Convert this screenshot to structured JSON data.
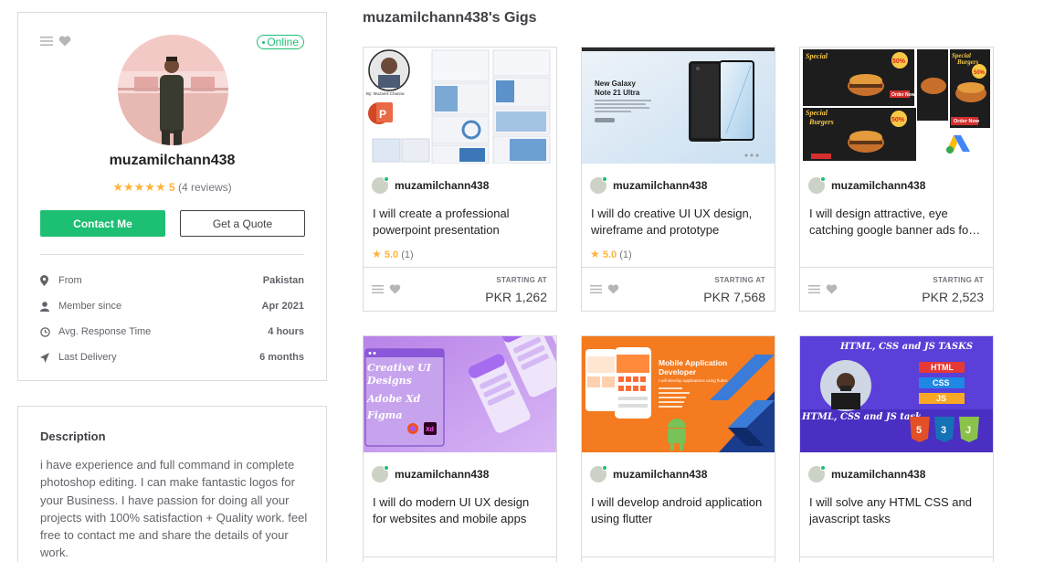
{
  "profile": {
    "status": "Online",
    "username": "muzamilchann438",
    "stars": "★★★★★",
    "rating": "5",
    "reviews": "(4 reviews)",
    "contact_label": "Contact Me",
    "quote_label": "Get a Quote",
    "stats": [
      {
        "icon": "location-pin-icon",
        "label": "From",
        "value": "Pakistan"
      },
      {
        "icon": "user-icon",
        "label": "Member since",
        "value": "Apr 2021"
      },
      {
        "icon": "clock-icon",
        "label": "Avg. Response Time",
        "value": "4 hours"
      },
      {
        "icon": "paper-plane-icon",
        "label": "Last Delivery",
        "value": "6 months"
      }
    ]
  },
  "description": {
    "title": "Description",
    "text": "i have experience and full command in complete photoshop editing. I can make fantastic logos for your Business. I have passion for doing all your projects with 100% satisfaction + Quality work. feel free to contact me and share the details of your work."
  },
  "gigs_title": "muzamilchann438's Gigs",
  "gigs": [
    {
      "seller": "muzamilchann438",
      "title": "I will create a professional powerpoint presentation",
      "star": "★",
      "rating": "5.0",
      "count": "(1)",
      "starting": "STARTING AT",
      "price": "PKR 1,262",
      "image_text": {
        "caption": "By: Muzamil Channa"
      }
    },
    {
      "seller": "muzamilchann438",
      "title": "I will do creative UI UX design, wireframe and prototype",
      "star": "★",
      "rating": "5.0",
      "count": "(1)",
      "starting": "STARTING AT",
      "price": "PKR 7,568",
      "image_text": {
        "line1": "New Galaxy",
        "line2": "Note 21 Ultra"
      }
    },
    {
      "seller": "muzamilchann438",
      "title": "I will design attractive, eye catching google banner ads for your business",
      "starting": "STARTING AT",
      "price": "PKR 2,523",
      "image_text": {
        "special": "Special",
        "burgers": "Burgers",
        "discount": "50%",
        "order": "Order Now"
      }
    },
    {
      "seller": "muzamilchann438",
      "title": "I will do modern UI UX design for websites and mobile apps",
      "image_text": {
        "l1": "Creative UI",
        "l2": "Designs",
        "l3": "Adobe Xd",
        "l4": "Figma",
        "xd": "Xd"
      }
    },
    {
      "seller": "muzamilchann438",
      "title": "I will develop android application using flutter",
      "image_text": {
        "h1": "Mobile Application",
        "h2": "Developer",
        "sub": "I will develop applications using flutter."
      }
    },
    {
      "seller": "muzamilchann438",
      "title": "I will solve any HTML CSS and javascript tasks",
      "image_text": {
        "head": "HTML, CSS and JS TASKS",
        "b1": "HTML",
        "b2": "CSS",
        "b3": "JS",
        "side": "HTML, CSS and JS task",
        "n1": "5",
        "n2": "3"
      }
    }
  ],
  "colors": {
    "accent": "#1dbf73",
    "star": "#ffb33e"
  }
}
